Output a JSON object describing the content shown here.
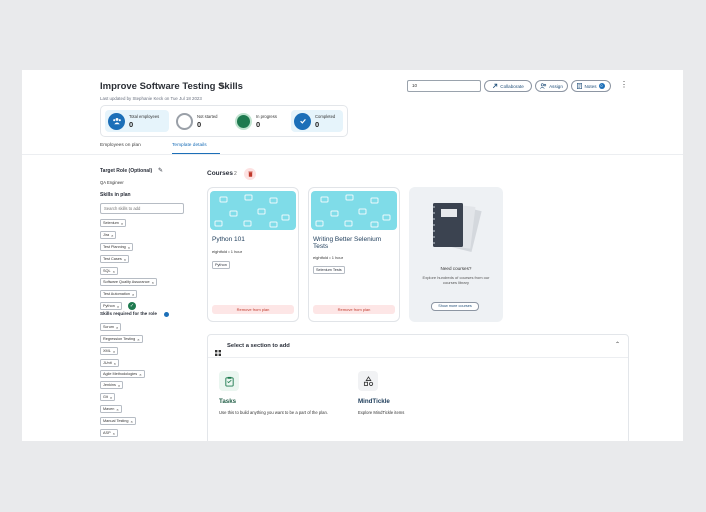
{
  "header": {
    "title": "Improve Software Testing Skills",
    "updated": "Last updated by Stephanie Keck on Tue Jul 18 2023",
    "input_value": "10",
    "collaborate": "Collaborate",
    "assign": "Assign",
    "notes": "Notes",
    "notes_count": "0"
  },
  "stats": [
    {
      "label": "Total employees",
      "value": "0"
    },
    {
      "label": "Not started",
      "value": "0"
    },
    {
      "label": "In progress",
      "value": "0"
    },
    {
      "label": "Completed",
      "value": "0"
    }
  ],
  "tabs": [
    {
      "label": "Employees on plan"
    },
    {
      "label": "Template details"
    }
  ],
  "sidebar": {
    "target_role_label": "Target Role (Optional)",
    "target_role": "QA Engineer",
    "skills_in_plan_label": "Skills in plan",
    "search_placeholder": "Search skills to add",
    "skills_in_plan": [
      "Selenium",
      "Jira",
      "Test Planning",
      "Test Cases",
      "SQL",
      "Software Quality Assurance",
      "Test Automation",
      "Python"
    ],
    "skills_required_label": "Skills required for the role",
    "skills_required": [
      "Scrum",
      "Regression Testing",
      "XML",
      "JUnit",
      "Agile Methodologies",
      "Jenkins",
      "Git",
      "Maven",
      "Manual Testing",
      "ASP"
    ]
  },
  "courses": {
    "label": "Courses",
    "count": "2",
    "items": [
      {
        "title": "Python 101",
        "provider": "eightfold • 1 hour",
        "tag": "Python",
        "remove": "Remove from plan"
      },
      {
        "title": "Writing Better Selenium Tests",
        "provider": "eightfold • 1 hour",
        "tag": "Selenium Tests",
        "remove": "Remove from plan"
      }
    ],
    "need_title": "Need courses?",
    "need_desc": "Explore hundreds of courses from our courses library",
    "show_more": "Show more courses"
  },
  "section": {
    "title": "Select a section to add",
    "items": [
      {
        "title": "Tasks",
        "desc": "Use this to build anything you want to be a part of the plan."
      },
      {
        "title": "MindTickle",
        "desc": "Explore MindTickle items"
      }
    ]
  },
  "colors": {
    "accent": "#1c6fb8",
    "course_banner": "#7fdce8",
    "remove": "#c0392b",
    "stat_bg": "#e6f4fb"
  }
}
